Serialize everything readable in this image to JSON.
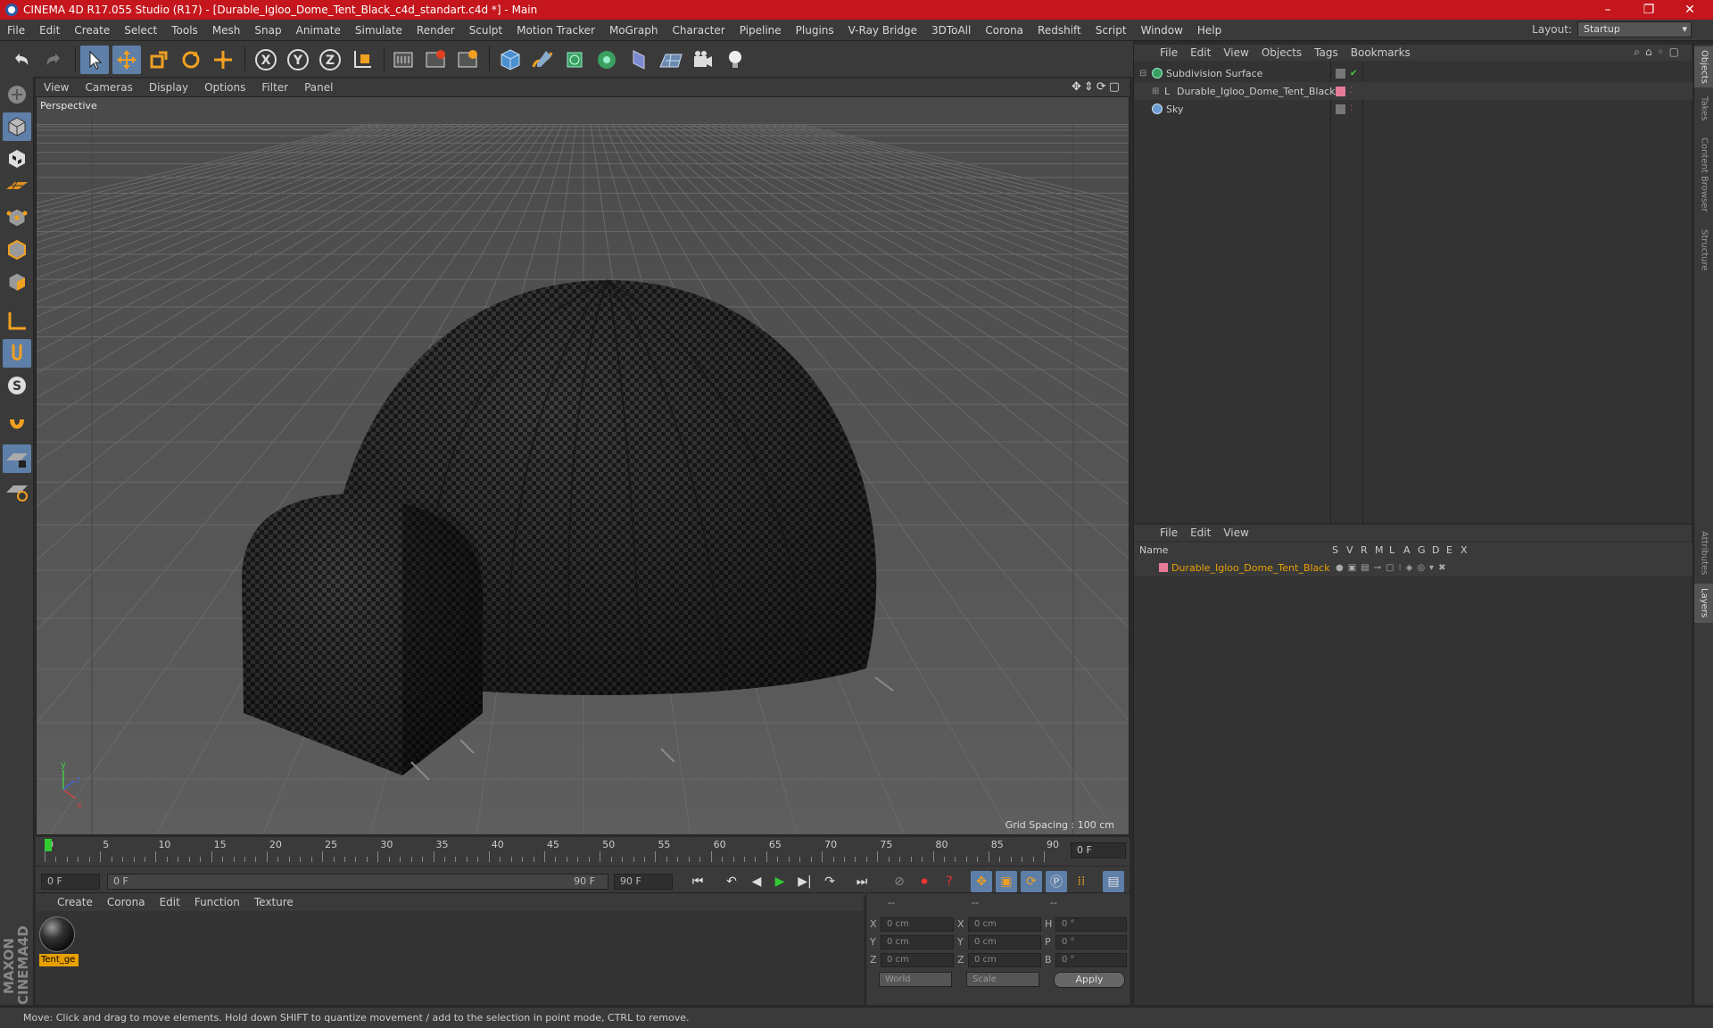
{
  "window": {
    "title": "CINEMA 4D R17.055 Studio (R17) - [Durable_Igloo_Dome_Tent_Black_c4d_standart.c4d *] - Main"
  },
  "menubar": {
    "items": [
      "File",
      "Edit",
      "Create",
      "Select",
      "Tools",
      "Mesh",
      "Snap",
      "Animate",
      "Simulate",
      "Render",
      "Sculpt",
      "Motion Tracker",
      "MoGraph",
      "Character",
      "Pipeline",
      "Plugins",
      "V-Ray Bridge",
      "3DToAll",
      "Corona",
      "Redshift",
      "Script",
      "Window",
      "Help"
    ],
    "layout_label": "Layout:",
    "layout_value": "Startup"
  },
  "viewport": {
    "menu": [
      "View",
      "Cameras",
      "Display",
      "Options",
      "Filter",
      "Panel"
    ],
    "label": "Perspective",
    "grid_spacing": "Grid Spacing : 100 cm"
  },
  "timeline": {
    "ticks": [
      "0",
      "5",
      "10",
      "15",
      "20",
      "25",
      "30",
      "35",
      "40",
      "45",
      "50",
      "55",
      "60",
      "65",
      "70",
      "75",
      "80",
      "85",
      "90"
    ],
    "current_frame": "0 F"
  },
  "transport": {
    "start_field": "0 F",
    "range_start": "0 F",
    "range_end": "90 F",
    "end_field": "90 F"
  },
  "materials": {
    "menu": [
      "Create",
      "Corona",
      "Edit",
      "Function",
      "Texture"
    ],
    "items": [
      {
        "name": "Tent_ge"
      }
    ]
  },
  "coords": {
    "header": [
      "--",
      "--",
      "--"
    ],
    "rows": [
      {
        "a": "X",
        "av": "0 cm",
        "b": "X",
        "bv": "0 cm",
        "c": "H",
        "cv": "0 °"
      },
      {
        "a": "Y",
        "av": "0 cm",
        "b": "Y",
        "bv": "0 cm",
        "c": "P",
        "cv": "0 °"
      },
      {
        "a": "Z",
        "av": "0 cm",
        "b": "Z",
        "bv": "0 cm",
        "c": "B",
        "cv": "0 °"
      }
    ],
    "space": "World",
    "mode": "Scale",
    "apply": "Apply"
  },
  "status": {
    "text": "Move: Click and drag to move elements. Hold down SHIFT to quantize movement / add to the selection in point mode, CTRL to remove."
  },
  "objects": {
    "menu": [
      "File",
      "Edit",
      "View",
      "Objects",
      "Tags",
      "Bookmarks"
    ],
    "items": [
      {
        "name": "Subdivision Surface"
      },
      {
        "name": "Durable_Igloo_Dome_Tent_Black"
      },
      {
        "name": "Sky"
      }
    ]
  },
  "layers": {
    "menu": [
      "File",
      "Edit",
      "View"
    ],
    "columns": [
      "Name",
      "S",
      "V",
      "R",
      "M",
      "L",
      "A",
      "G",
      "D",
      "E",
      "X"
    ],
    "items": [
      {
        "name": "Durable_Igloo_Dome_Tent_Black",
        "color": "#e87a9a"
      }
    ]
  },
  "right_tabs": [
    "Objects",
    "Takes",
    "Content Browser",
    "Structure",
    "Attributes",
    "Layers"
  ],
  "colors": {
    "accent": "#5e7fa8",
    "title_bar": "#c4161c",
    "highlight": "#e8a000"
  }
}
